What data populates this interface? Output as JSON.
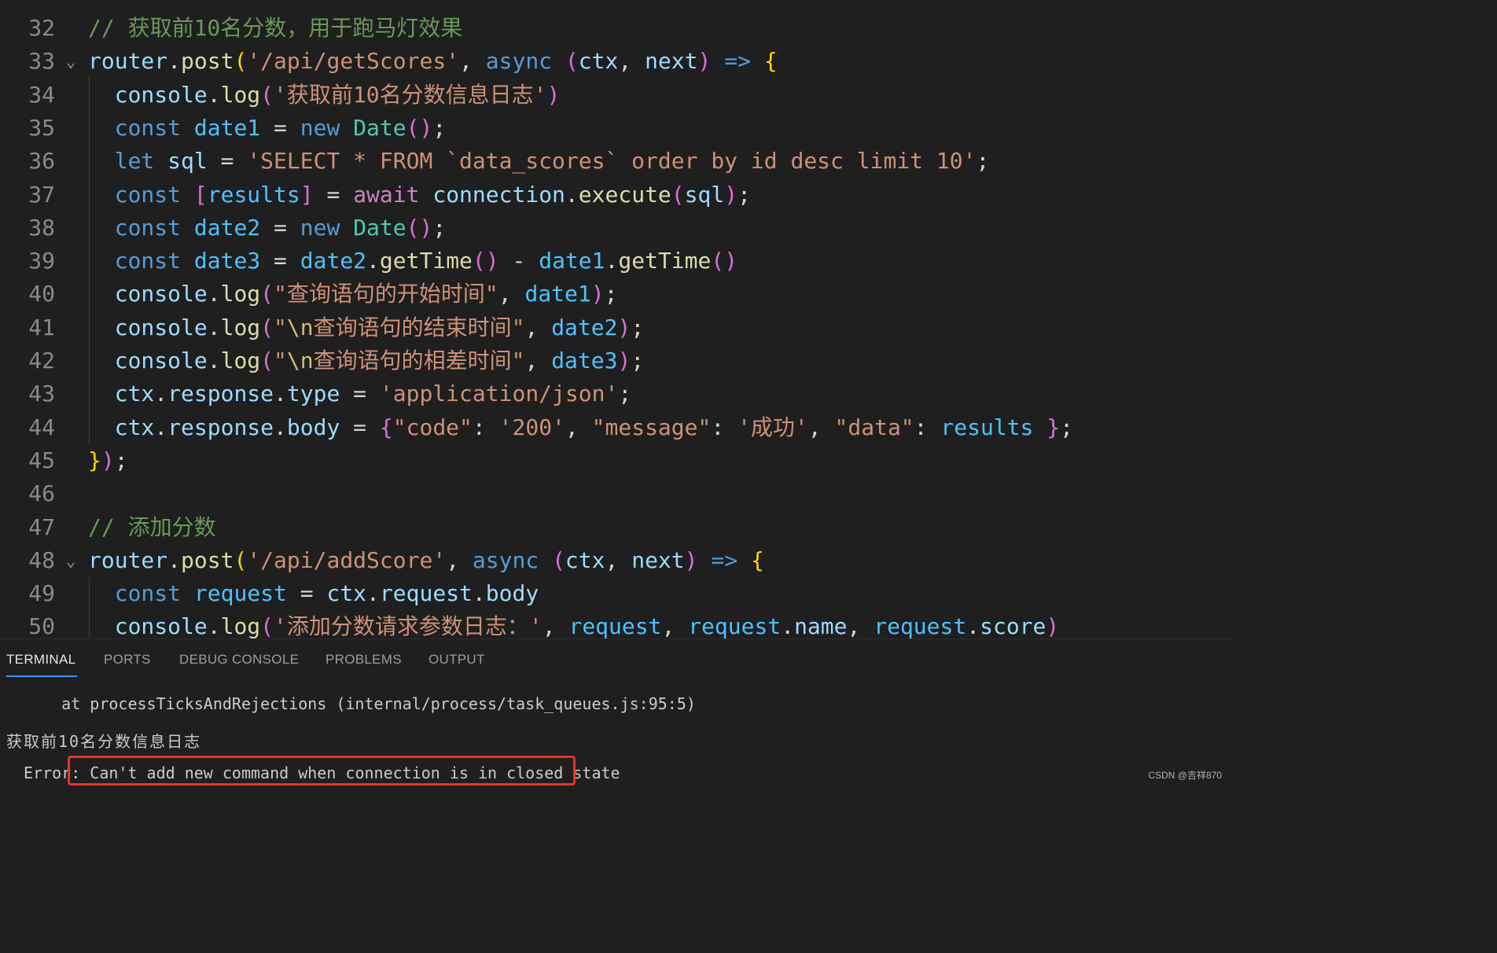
{
  "editor": {
    "lines": [
      {
        "num": "32",
        "fold": false,
        "tokens": [
          [
            "t-cmt",
            "// 获取前10名分数，用于跑马灯效果"
          ]
        ]
      },
      {
        "num": "33",
        "fold": true,
        "tokens": [
          [
            "t-var",
            "router"
          ],
          [
            "t-op",
            "."
          ],
          [
            "t-fn",
            "post"
          ],
          [
            "t-br1",
            "("
          ],
          [
            "t-str",
            "'/api/getScores'"
          ],
          [
            "t-op",
            ", "
          ],
          [
            "t-kw",
            "async"
          ],
          [
            "t-op",
            " "
          ],
          [
            "t-br2",
            "("
          ],
          [
            "t-var",
            "ctx"
          ],
          [
            "t-op",
            ", "
          ],
          [
            "t-par",
            "next"
          ],
          [
            "t-br2",
            ")"
          ],
          [
            "t-op",
            " "
          ],
          [
            "t-kw",
            "=>"
          ],
          [
            "t-op",
            " "
          ],
          [
            "t-br1",
            "{"
          ]
        ]
      },
      {
        "num": "34",
        "fold": false,
        "tokens": [
          [
            "t-op",
            "  "
          ],
          [
            "t-var",
            "console"
          ],
          [
            "t-op",
            "."
          ],
          [
            "t-fn",
            "log"
          ],
          [
            "t-br2",
            "("
          ],
          [
            "t-str",
            "'获取前10名分数信息日志'"
          ],
          [
            "t-br2",
            ")"
          ]
        ]
      },
      {
        "num": "35",
        "fold": false,
        "tokens": [
          [
            "t-op",
            "  "
          ],
          [
            "t-kw",
            "const"
          ],
          [
            "t-op",
            " "
          ],
          [
            "t-const",
            "date1"
          ],
          [
            "t-op",
            " = "
          ],
          [
            "t-kw",
            "new"
          ],
          [
            "t-op",
            " "
          ],
          [
            "t-cls",
            "Date"
          ],
          [
            "t-br2",
            "()"
          ],
          [
            "t-op",
            ";"
          ]
        ]
      },
      {
        "num": "36",
        "fold": false,
        "tokens": [
          [
            "t-op",
            "  "
          ],
          [
            "t-kw",
            "let"
          ],
          [
            "t-op",
            " "
          ],
          [
            "t-var",
            "sql"
          ],
          [
            "t-op",
            " = "
          ],
          [
            "t-str",
            "'SELECT * FROM `data_scores` order by id desc limit 10'"
          ],
          [
            "t-op",
            ";"
          ]
        ]
      },
      {
        "num": "37",
        "fold": false,
        "tokens": [
          [
            "t-op",
            "  "
          ],
          [
            "t-kw",
            "const"
          ],
          [
            "t-op",
            " "
          ],
          [
            "t-br2",
            "["
          ],
          [
            "t-const",
            "results"
          ],
          [
            "t-br2",
            "]"
          ],
          [
            "t-op",
            " = "
          ],
          [
            "t-ctl",
            "await"
          ],
          [
            "t-op",
            " "
          ],
          [
            "t-var",
            "connection"
          ],
          [
            "t-op",
            "."
          ],
          [
            "t-fn",
            "execute"
          ],
          [
            "t-br2",
            "("
          ],
          [
            "t-var",
            "sql"
          ],
          [
            "t-br2",
            ")"
          ],
          [
            "t-op",
            ";"
          ]
        ]
      },
      {
        "num": "38",
        "fold": false,
        "tokens": [
          [
            "t-op",
            "  "
          ],
          [
            "t-kw",
            "const"
          ],
          [
            "t-op",
            " "
          ],
          [
            "t-const",
            "date2"
          ],
          [
            "t-op",
            " = "
          ],
          [
            "t-kw",
            "new"
          ],
          [
            "t-op",
            " "
          ],
          [
            "t-cls",
            "Date"
          ],
          [
            "t-br2",
            "()"
          ],
          [
            "t-op",
            ";"
          ]
        ]
      },
      {
        "num": "39",
        "fold": false,
        "tokens": [
          [
            "t-op",
            "  "
          ],
          [
            "t-kw",
            "const"
          ],
          [
            "t-op",
            " "
          ],
          [
            "t-const",
            "date3"
          ],
          [
            "t-op",
            " = "
          ],
          [
            "t-const",
            "date2"
          ],
          [
            "t-op",
            "."
          ],
          [
            "t-fn",
            "getTime"
          ],
          [
            "t-br2",
            "()"
          ],
          [
            "t-op",
            " - "
          ],
          [
            "t-const",
            "date1"
          ],
          [
            "t-op",
            "."
          ],
          [
            "t-fn",
            "getTime"
          ],
          [
            "t-br2",
            "()"
          ]
        ]
      },
      {
        "num": "40",
        "fold": false,
        "tokens": [
          [
            "t-op",
            "  "
          ],
          [
            "t-var",
            "console"
          ],
          [
            "t-op",
            "."
          ],
          [
            "t-fn",
            "log"
          ],
          [
            "t-br2",
            "("
          ],
          [
            "t-str",
            "\"查询语句的开始时间\""
          ],
          [
            "t-op",
            ", "
          ],
          [
            "t-const",
            "date1"
          ],
          [
            "t-br2",
            ")"
          ],
          [
            "t-op",
            ";"
          ]
        ]
      },
      {
        "num": "41",
        "fold": false,
        "tokens": [
          [
            "t-op",
            "  "
          ],
          [
            "t-var",
            "console"
          ],
          [
            "t-op",
            "."
          ],
          [
            "t-fn",
            "log"
          ],
          [
            "t-br2",
            "("
          ],
          [
            "t-str",
            "\""
          ],
          [
            "t-esc",
            "\\n"
          ],
          [
            "t-str",
            "查询语句的结束时间\""
          ],
          [
            "t-op",
            ", "
          ],
          [
            "t-const",
            "date2"
          ],
          [
            "t-br2",
            ")"
          ],
          [
            "t-op",
            ";"
          ]
        ]
      },
      {
        "num": "42",
        "fold": false,
        "tokens": [
          [
            "t-op",
            "  "
          ],
          [
            "t-var",
            "console"
          ],
          [
            "t-op",
            "."
          ],
          [
            "t-fn",
            "log"
          ],
          [
            "t-br2",
            "("
          ],
          [
            "t-str",
            "\""
          ],
          [
            "t-esc",
            "\\n"
          ],
          [
            "t-str",
            "查询语句的相差时间\""
          ],
          [
            "t-op",
            ", "
          ],
          [
            "t-const",
            "date3"
          ],
          [
            "t-br2",
            ")"
          ],
          [
            "t-op",
            ";"
          ]
        ]
      },
      {
        "num": "43",
        "fold": false,
        "tokens": [
          [
            "t-op",
            "  "
          ],
          [
            "t-var",
            "ctx"
          ],
          [
            "t-op",
            "."
          ],
          [
            "t-var",
            "response"
          ],
          [
            "t-op",
            "."
          ],
          [
            "t-var",
            "type"
          ],
          [
            "t-op",
            " = "
          ],
          [
            "t-str",
            "'application/json'"
          ],
          [
            "t-op",
            ";"
          ]
        ]
      },
      {
        "num": "44",
        "fold": false,
        "tokens": [
          [
            "t-op",
            "  "
          ],
          [
            "t-var",
            "ctx"
          ],
          [
            "t-op",
            "."
          ],
          [
            "t-var",
            "response"
          ],
          [
            "t-op",
            "."
          ],
          [
            "t-var",
            "body"
          ],
          [
            "t-op",
            " = "
          ],
          [
            "t-br2",
            "{"
          ],
          [
            "t-str",
            "\"code\""
          ],
          [
            "t-op",
            ": "
          ],
          [
            "t-str",
            "'200'"
          ],
          [
            "t-op",
            ", "
          ],
          [
            "t-str",
            "\"message\""
          ],
          [
            "t-op",
            ": "
          ],
          [
            "t-str",
            "'成功'"
          ],
          [
            "t-op",
            ", "
          ],
          [
            "t-str",
            "\"data\""
          ],
          [
            "t-op",
            ": "
          ],
          [
            "t-const",
            "results"
          ],
          [
            "t-op",
            " "
          ],
          [
            "t-br2",
            "}"
          ],
          [
            "t-op",
            ";"
          ]
        ]
      },
      {
        "num": "45",
        "fold": false,
        "tokens": [
          [
            "t-br1",
            "}"
          ],
          [
            "t-br2",
            ")"
          ],
          [
            "t-op",
            ";"
          ]
        ]
      },
      {
        "num": "46",
        "fold": false,
        "tokens": []
      },
      {
        "num": "47",
        "fold": false,
        "tokens": [
          [
            "t-cmt",
            "// 添加分数"
          ]
        ]
      },
      {
        "num": "48",
        "fold": true,
        "tokens": [
          [
            "t-var",
            "router"
          ],
          [
            "t-op",
            "."
          ],
          [
            "t-fn",
            "post"
          ],
          [
            "t-br1",
            "("
          ],
          [
            "t-str",
            "'/api/addScore'"
          ],
          [
            "t-op",
            ", "
          ],
          [
            "t-kw",
            "async"
          ],
          [
            "t-op",
            " "
          ],
          [
            "t-br2",
            "("
          ],
          [
            "t-var",
            "ctx"
          ],
          [
            "t-op",
            ", "
          ],
          [
            "t-par",
            "next"
          ],
          [
            "t-br2",
            ")"
          ],
          [
            "t-op",
            " "
          ],
          [
            "t-kw",
            "=>"
          ],
          [
            "t-op",
            " "
          ],
          [
            "t-br1",
            "{"
          ]
        ]
      },
      {
        "num": "49",
        "fold": false,
        "tokens": [
          [
            "t-op",
            "  "
          ],
          [
            "t-kw",
            "const"
          ],
          [
            "t-op",
            " "
          ],
          [
            "t-const",
            "request"
          ],
          [
            "t-op",
            " = "
          ],
          [
            "t-var",
            "ctx"
          ],
          [
            "t-op",
            "."
          ],
          [
            "t-var",
            "request"
          ],
          [
            "t-op",
            "."
          ],
          [
            "t-var",
            "body"
          ]
        ]
      },
      {
        "num": "50",
        "fold": false,
        "tokens": [
          [
            "t-op",
            "  "
          ],
          [
            "t-var",
            "console"
          ],
          [
            "t-op",
            "."
          ],
          [
            "t-fn",
            "log"
          ],
          [
            "t-br2",
            "("
          ],
          [
            "t-str",
            "'添加分数请求参数日志：'"
          ],
          [
            "t-op",
            ", "
          ],
          [
            "t-const",
            "request"
          ],
          [
            "t-op",
            ", "
          ],
          [
            "t-const",
            "request"
          ],
          [
            "t-op",
            "."
          ],
          [
            "t-var",
            "name"
          ],
          [
            "t-op",
            ", "
          ],
          [
            "t-const",
            "request"
          ],
          [
            "t-op",
            "."
          ],
          [
            "t-var",
            "score"
          ],
          [
            "t-br2",
            ")"
          ]
        ]
      }
    ]
  },
  "panel": {
    "tabs": [
      {
        "label": "TERMINAL",
        "active": true
      },
      {
        "label": "PORTS",
        "active": false
      },
      {
        "label": "DEBUG CONSOLE",
        "active": false
      },
      {
        "label": "PROBLEMS",
        "active": false
      },
      {
        "label": "OUTPUT",
        "active": false
      }
    ],
    "terminal": {
      "line1": "    at processTicksAndRejections (internal/process/task_queues.js:95:5)",
      "line2": "获取前10名分数信息日志",
      "error_prefix": "Error: ",
      "error_message": "Can't add new command when connection is in closed state"
    }
  },
  "watermark": "CSDN @吉祥870"
}
